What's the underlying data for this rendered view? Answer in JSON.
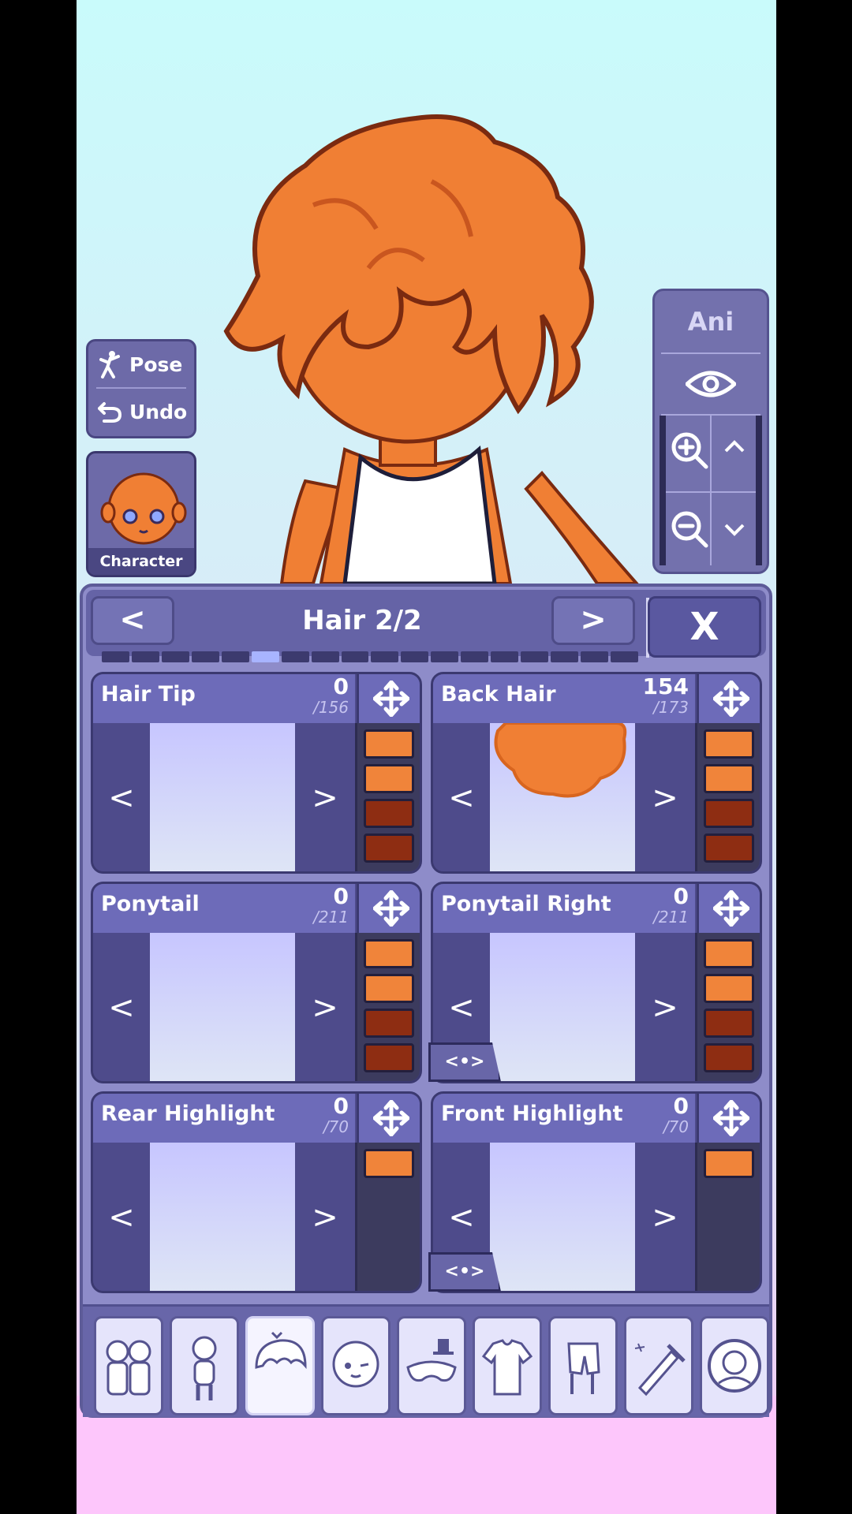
{
  "left_controls": {
    "pose_label": "Pose",
    "undo_label": "Undo",
    "character_label": "Character"
  },
  "right_controls": {
    "ani_label": "Ani"
  },
  "panel": {
    "title": "Hair 2/2",
    "prev_label": "<",
    "next_label": ">",
    "close_label": "X",
    "progress_segments": 18,
    "progress_active_index": 5
  },
  "cards": [
    {
      "name": "Hair Tip",
      "value": "0",
      "total": "/156",
      "swatches": [
        "#f0843a",
        "#f0843a",
        "#8e2d12",
        "#8e2d12"
      ]
    },
    {
      "name": "Back Hair",
      "value": "154",
      "total": "/173",
      "swatches": [
        "#f0843a",
        "#f0843a",
        "#8e2d12",
        "#8e2d12"
      ]
    },
    {
      "name": "Ponytail",
      "value": "0",
      "total": "/211",
      "swatches": [
        "#f0843a",
        "#f0843a",
        "#8e2d12",
        "#8e2d12"
      ]
    },
    {
      "name": "Ponytail Right",
      "value": "0",
      "total": "/211",
      "swatches": [
        "#f0843a",
        "#f0843a",
        "#8e2d12",
        "#8e2d12"
      ]
    },
    {
      "name": "Rear Highlight",
      "value": "0",
      "total": "/70",
      "swatches": [
        "#f0843a"
      ]
    },
    {
      "name": "Front Highlight",
      "value": "0",
      "total": "/70",
      "swatches": [
        "#f0843a"
      ]
    }
  ],
  "card_nav": {
    "left": "<",
    "right": ">"
  },
  "mirror_label": "<•>",
  "tabs": [
    {
      "icon": "group-characters-icon"
    },
    {
      "icon": "body-icon"
    },
    {
      "icon": "hair-icon",
      "active": true
    },
    {
      "icon": "face-icon"
    },
    {
      "icon": "mask-hat-icon"
    },
    {
      "icon": "shirt-icon"
    },
    {
      "icon": "pants-icon"
    },
    {
      "icon": "sword-accessory-icon"
    },
    {
      "icon": "profile-icon"
    }
  ],
  "colors": {
    "hair_orange": "#f0843a",
    "hair_dark": "#8e2d12",
    "panel_purple": "#6d6bb9"
  }
}
